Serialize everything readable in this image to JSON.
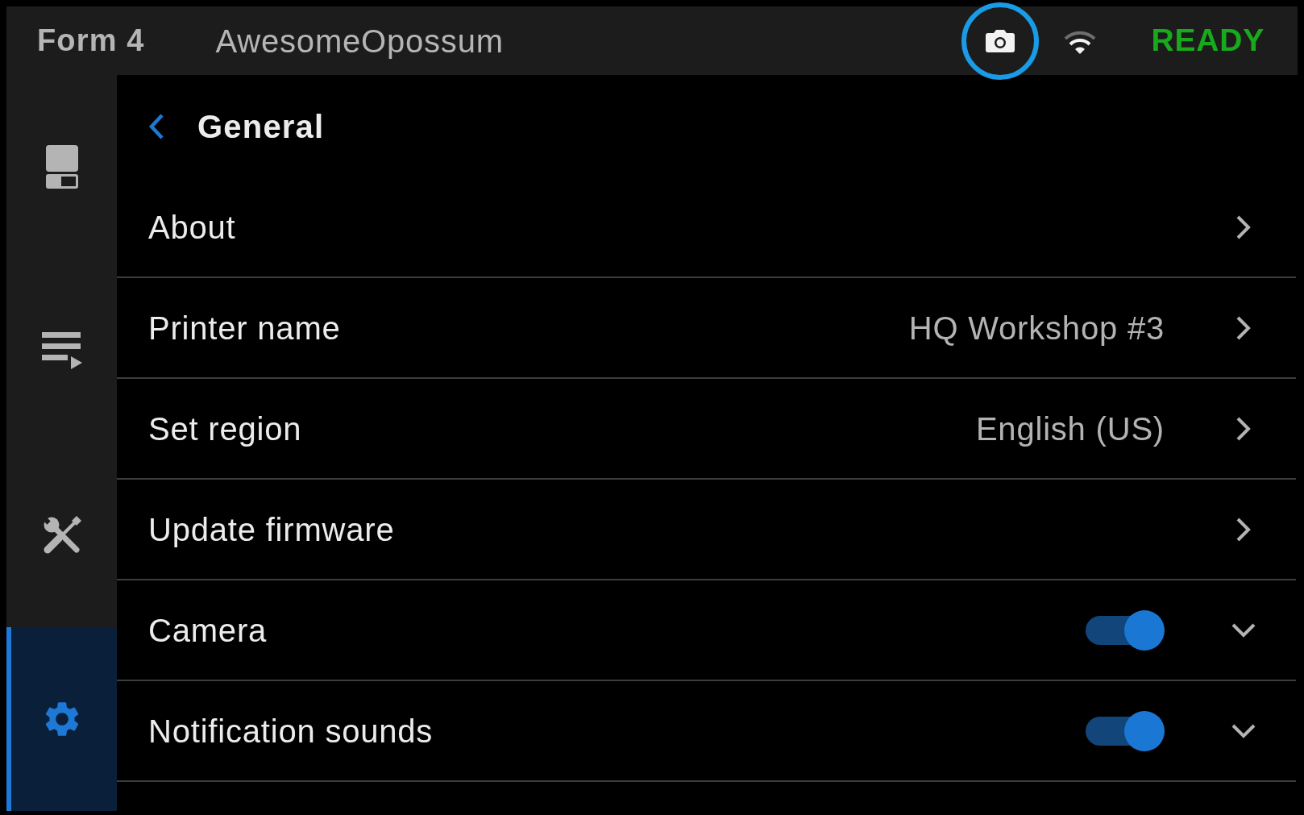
{
  "top_bar": {
    "model": "Form 4",
    "printer_name": "AwesomeOpossum",
    "camera": {
      "highlighted": true
    },
    "status": "READY"
  },
  "sidebar": {
    "items": [
      {
        "kind": "printer",
        "selected": false
      },
      {
        "kind": "queue",
        "selected": false
      },
      {
        "kind": "tools",
        "selected": false
      },
      {
        "kind": "settings",
        "selected": true
      }
    ]
  },
  "page": {
    "title": "General"
  },
  "settings": [
    {
      "kind": "link",
      "label": "About"
    },
    {
      "kind": "link",
      "label": "Printer name",
      "value": "HQ Workshop #3"
    },
    {
      "kind": "link",
      "label": "Set region",
      "value": "English (US)"
    },
    {
      "kind": "link",
      "label": "Update firmware"
    },
    {
      "kind": "toggle",
      "label": "Camera",
      "on": true,
      "expanded": false
    },
    {
      "kind": "toggle",
      "label": "Notification sounds",
      "on": true,
      "expanded": false
    }
  ]
}
